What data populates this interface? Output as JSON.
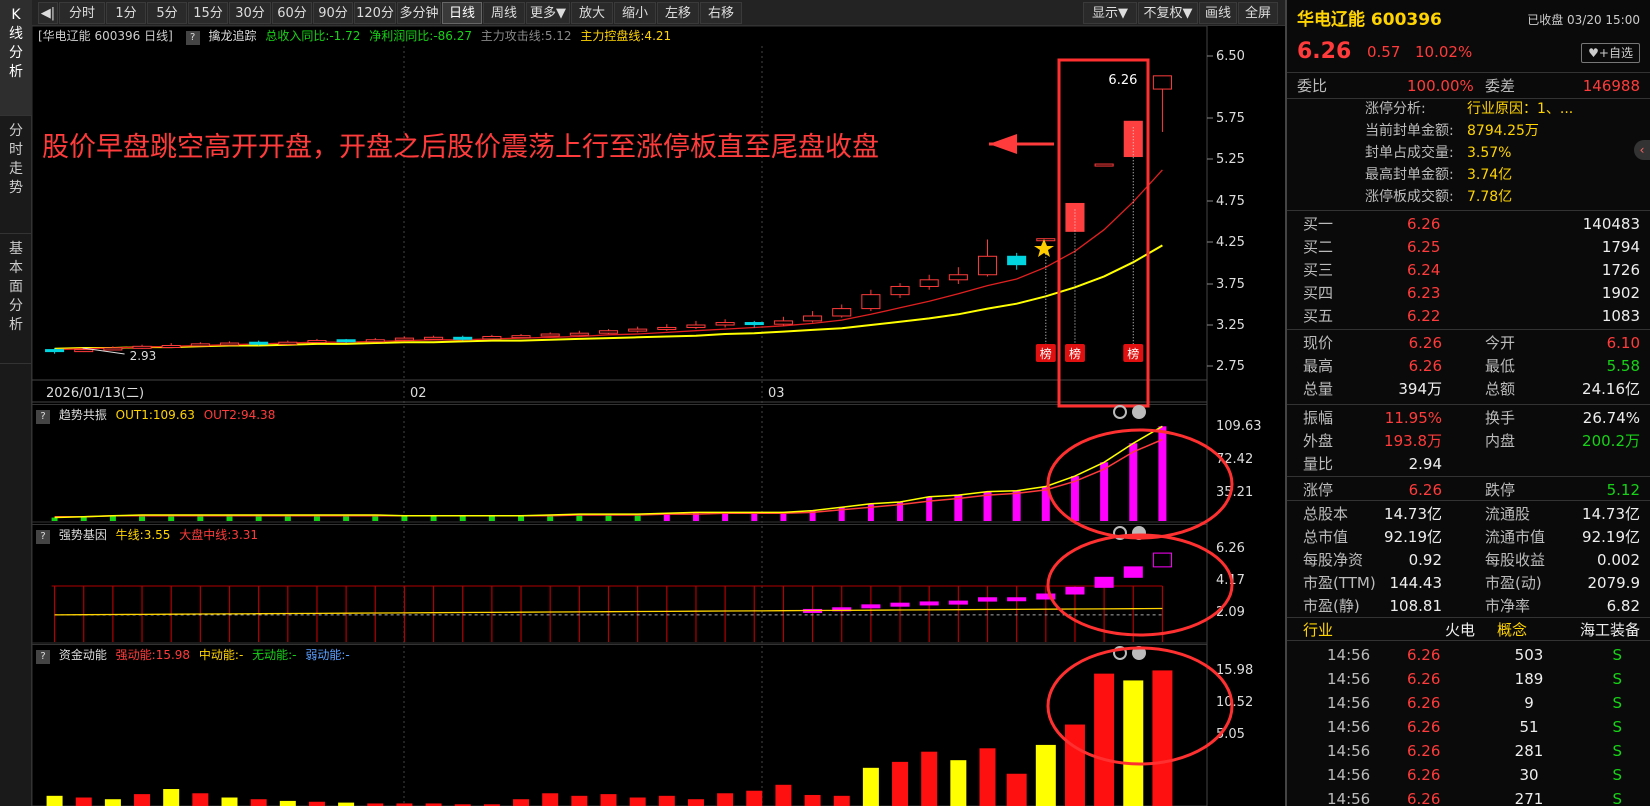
{
  "side_tabs": [
    "K线分析",
    "分时走势",
    "基本面分析"
  ],
  "toolbar": {
    "items": [
      "◀|",
      "分时",
      "1分",
      "5分",
      "15分",
      "30分",
      "60分",
      "90分",
      "120分",
      "多分钟",
      "日线",
      "周线",
      "更多▼",
      "放大",
      "缩小",
      "左移",
      "右移"
    ],
    "right_items": [
      "显示▼",
      "不复权▼",
      "画线",
      "全屏"
    ]
  },
  "main_info": {
    "name": "[华电辽能 600396 日线]",
    "indicator": "擒龙追踪",
    "revenue_yoy": "总收入同比:-1.72",
    "profit_yoy": "净利润同比:-86.27",
    "attack_line": "主力攻击线:5.12",
    "control_line": "主力控盘线:4.21"
  },
  "annotation": "股价早盘跳空高开开盘，开盘之后股价震荡上行至涨停板直至尾盘收盘",
  "price_axis": [
    "6.50",
    "5.75",
    "5.25",
    "4.75",
    "4.25",
    "3.75",
    "3.25",
    "2.75"
  ],
  "date_axis": [
    "2026/01/13(二)",
    "02",
    "03"
  ],
  "last_price_label": "6.26",
  "low_price_label": "2.93",
  "bang_label": "榜",
  "ind1": {
    "name": "趋势共振",
    "out1": "OUT1:109.63",
    "out2": "OUT2:94.38",
    "axis": [
      "109.63",
      "72.42",
      "35.21"
    ]
  },
  "ind2": {
    "name": "强势基因",
    "bull": "牛线:3.55",
    "market": "大盘中线:3.31",
    "axis": [
      "6.26",
      "4.17",
      "2.09"
    ]
  },
  "ind3": {
    "name": "资金动能",
    "strong": "强动能:15.98",
    "mid": "中动能:-",
    "none": "无动能:-",
    "weak": "弱动能:-",
    "axis": [
      "15.98",
      "10.52",
      "5.05"
    ]
  },
  "panel": {
    "title": "华电辽能 600396",
    "status": "已收盘 03/20 15:00",
    "price": "6.26",
    "change": "0.57",
    "pct": "10.02%",
    "watch": "♥+自选",
    "weibi_label": "委比",
    "weibi": "100.00%",
    "weicha_label": "委差",
    "weicha": "146988",
    "limit": [
      [
        "涨停分析:",
        "行业原因：1、..."
      ],
      [
        "当前封单金额:",
        "8794.25万"
      ],
      [
        "封单占成交量:",
        "3.57%"
      ],
      [
        "最高封单金额:",
        "3.74亿"
      ],
      [
        "涨停板成交额:",
        "7.78亿"
      ]
    ],
    "bids": [
      [
        "买一",
        "6.26",
        "140483"
      ],
      [
        "买二",
        "6.25",
        "1794"
      ],
      [
        "买三",
        "6.24",
        "1726"
      ],
      [
        "买四",
        "6.23",
        "1902"
      ],
      [
        "买五",
        "6.22",
        "1083"
      ]
    ],
    "stats": [
      [
        "现价",
        "6.26",
        "今开",
        "6.10"
      ],
      [
        "最高",
        "6.26",
        "最低",
        "5.58"
      ],
      [
        "总量",
        "394万",
        "总额",
        "24.16亿"
      ],
      [
        "振幅",
        "11.95%",
        "换手",
        "26.74%"
      ],
      [
        "外盘",
        "193.8万",
        "内盘",
        "200.2万"
      ],
      [
        "量比",
        "2.94",
        "",
        ""
      ],
      [
        "涨停",
        "6.26",
        "跌停",
        "5.12"
      ],
      [
        "总股本",
        "14.73亿",
        "流通股",
        "14.73亿"
      ],
      [
        "总市值",
        "92.19亿",
        "流通市值",
        "92.19亿"
      ],
      [
        "每股净资",
        "0.92",
        "每股收益",
        "0.002"
      ],
      [
        "市盈(TTM)",
        "144.43",
        "市盈(动)",
        "2079.9"
      ],
      [
        "市盈(静)",
        "108.81",
        "市净率",
        "6.82"
      ]
    ],
    "industry": [
      "行业",
      "火电",
      "概念",
      "海工装备"
    ],
    "ticks": [
      [
        "14:56",
        "6.26",
        "503",
        "S"
      ],
      [
        "14:56",
        "6.26",
        "189",
        "S"
      ],
      [
        "14:56",
        "6.26",
        "9",
        "S"
      ],
      [
        "14:56",
        "6.26",
        "51",
        "S"
      ],
      [
        "14:56",
        "6.26",
        "281",
        "S"
      ],
      [
        "14:56",
        "6.26",
        "30",
        "S"
      ],
      [
        "14:56",
        "6.26",
        "271",
        "S"
      ]
    ]
  },
  "chart_data": {
    "type": "candlestick",
    "closes": [
      2.93,
      2.95,
      2.97,
      2.99,
      3.0,
      3.02,
      3.03,
      3.02,
      3.04,
      3.06,
      3.05,
      3.07,
      3.09,
      3.1,
      3.08,
      3.11,
      3.12,
      3.14,
      3.15,
      3.18,
      3.2,
      3.22,
      3.25,
      3.28,
      3.26,
      3.3,
      3.36,
      3.45,
      3.62,
      3.72,
      3.8,
      3.86,
      4.08,
      3.98,
      4.29,
      4.72,
      5.19,
      5.71,
      6.26
    ],
    "opens": [
      2.95,
      2.93,
      2.97,
      2.97,
      2.99,
      3.02,
      3.02,
      3.04,
      3.02,
      3.04,
      3.07,
      3.05,
      3.07,
      3.09,
      3.1,
      3.08,
      3.11,
      3.12,
      3.14,
      3.15,
      3.18,
      3.2,
      3.22,
      3.25,
      3.28,
      3.26,
      3.3,
      3.36,
      3.45,
      3.62,
      3.72,
      3.8,
      3.86,
      4.08,
      4.29,
      4.38,
      5.19,
      5.28,
      6.1
    ],
    "highs": [
      2.97,
      2.97,
      2.99,
      3.01,
      3.03,
      3.04,
      3.05,
      3.06,
      3.06,
      3.08,
      3.08,
      3.09,
      3.11,
      3.12,
      3.12,
      3.13,
      3.14,
      3.16,
      3.18,
      3.2,
      3.23,
      3.26,
      3.3,
      3.32,
      3.3,
      3.35,
      3.42,
      3.5,
      3.68,
      3.76,
      3.86,
      3.95,
      4.28,
      4.12,
      4.29,
      4.72,
      5.19,
      5.71,
      6.26
    ],
    "lows": [
      2.9,
      2.92,
      2.94,
      2.96,
      2.98,
      3.0,
      3.01,
      3.0,
      3.01,
      3.03,
      3.03,
      3.04,
      3.06,
      3.07,
      3.06,
      3.07,
      3.09,
      3.11,
      3.12,
      3.14,
      3.16,
      3.18,
      3.2,
      3.22,
      3.22,
      3.24,
      3.28,
      3.34,
      3.42,
      3.58,
      3.68,
      3.75,
      3.84,
      3.92,
      4.29,
      4.38,
      5.19,
      5.28,
      5.58
    ],
    "ma_fast": [
      2.95,
      2.96,
      2.97,
      2.98,
      2.99,
      3.0,
      3.01,
      3.02,
      3.03,
      3.04,
      3.04,
      3.05,
      3.06,
      3.07,
      3.07,
      3.08,
      3.09,
      3.1,
      3.11,
      3.13,
      3.14,
      3.16,
      3.18,
      3.2,
      3.22,
      3.24,
      3.27,
      3.31,
      3.38,
      3.46,
      3.54,
      3.63,
      3.73,
      3.81,
      3.95,
      4.14,
      4.4,
      4.74,
      5.12
    ],
    "ma_slow": [
      2.96,
      2.97,
      2.97,
      2.98,
      2.98,
      2.99,
      3.0,
      3.0,
      3.01,
      3.02,
      3.02,
      3.03,
      3.04,
      3.04,
      3.05,
      3.06,
      3.06,
      3.07,
      3.08,
      3.09,
      3.1,
      3.11,
      3.12,
      3.14,
      3.15,
      3.17,
      3.19,
      3.21,
      3.25,
      3.29,
      3.33,
      3.38,
      3.45,
      3.51,
      3.6,
      3.71,
      3.84,
      4.01,
      4.21
    ],
    "ind1_out1": [
      4,
      5,
      6,
      7,
      7,
      7,
      7,
      7,
      7,
      7,
      7,
      7,
      6,
      6,
      6,
      6,
      6,
      7,
      8,
      8,
      8,
      9,
      10,
      10,
      10,
      10,
      12,
      16,
      20,
      22,
      28,
      30,
      34,
      35,
      40,
      52,
      68,
      90,
      109.63
    ],
    "ind1_out2": [
      5,
      5,
      6,
      6,
      6,
      6,
      6,
      6,
      6,
      6,
      6,
      6,
      6,
      6,
      6,
      6,
      6,
      6,
      7,
      7,
      7,
      8,
      8,
      9,
      9,
      9,
      10,
      13,
      16,
      19,
      23,
      26,
      30,
      32,
      36,
      46,
      60,
      80,
      94.38
    ],
    "ind2_values": [
      3.3,
      3.3,
      3.31,
      3.32,
      3.33,
      3.33,
      3.32,
      3.33,
      3.34,
      3.35,
      3.34,
      3.35,
      3.36,
      3.37,
      3.36,
      3.37,
      3.38,
      3.39,
      3.4,
      3.42,
      3.44,
      3.46,
      3.48,
      3.5,
      3.49,
      3.52,
      3.56,
      3.64,
      3.78,
      3.86,
      3.92,
      3.96,
      4.12,
      4.06,
      4.3,
      4.62,
      5.1,
      5.6,
      6.26
    ],
    "ind3_values": [
      1.2,
      1.0,
      0.8,
      1.4,
      2.0,
      1.5,
      1.0,
      0.8,
      0.6,
      0.5,
      0.4,
      0.3,
      0.3,
      0.3,
      0.2,
      0.2,
      0.8,
      1.5,
      1.2,
      1.4,
      1.0,
      1.2,
      0.8,
      1.5,
      1.8,
      2.5,
      1.3,
      1.2,
      4.5,
      5.2,
      6.4,
      5.4,
      6.8,
      3.8,
      7.2,
      9.6,
      15.6,
      14.8,
      15.98
    ]
  }
}
